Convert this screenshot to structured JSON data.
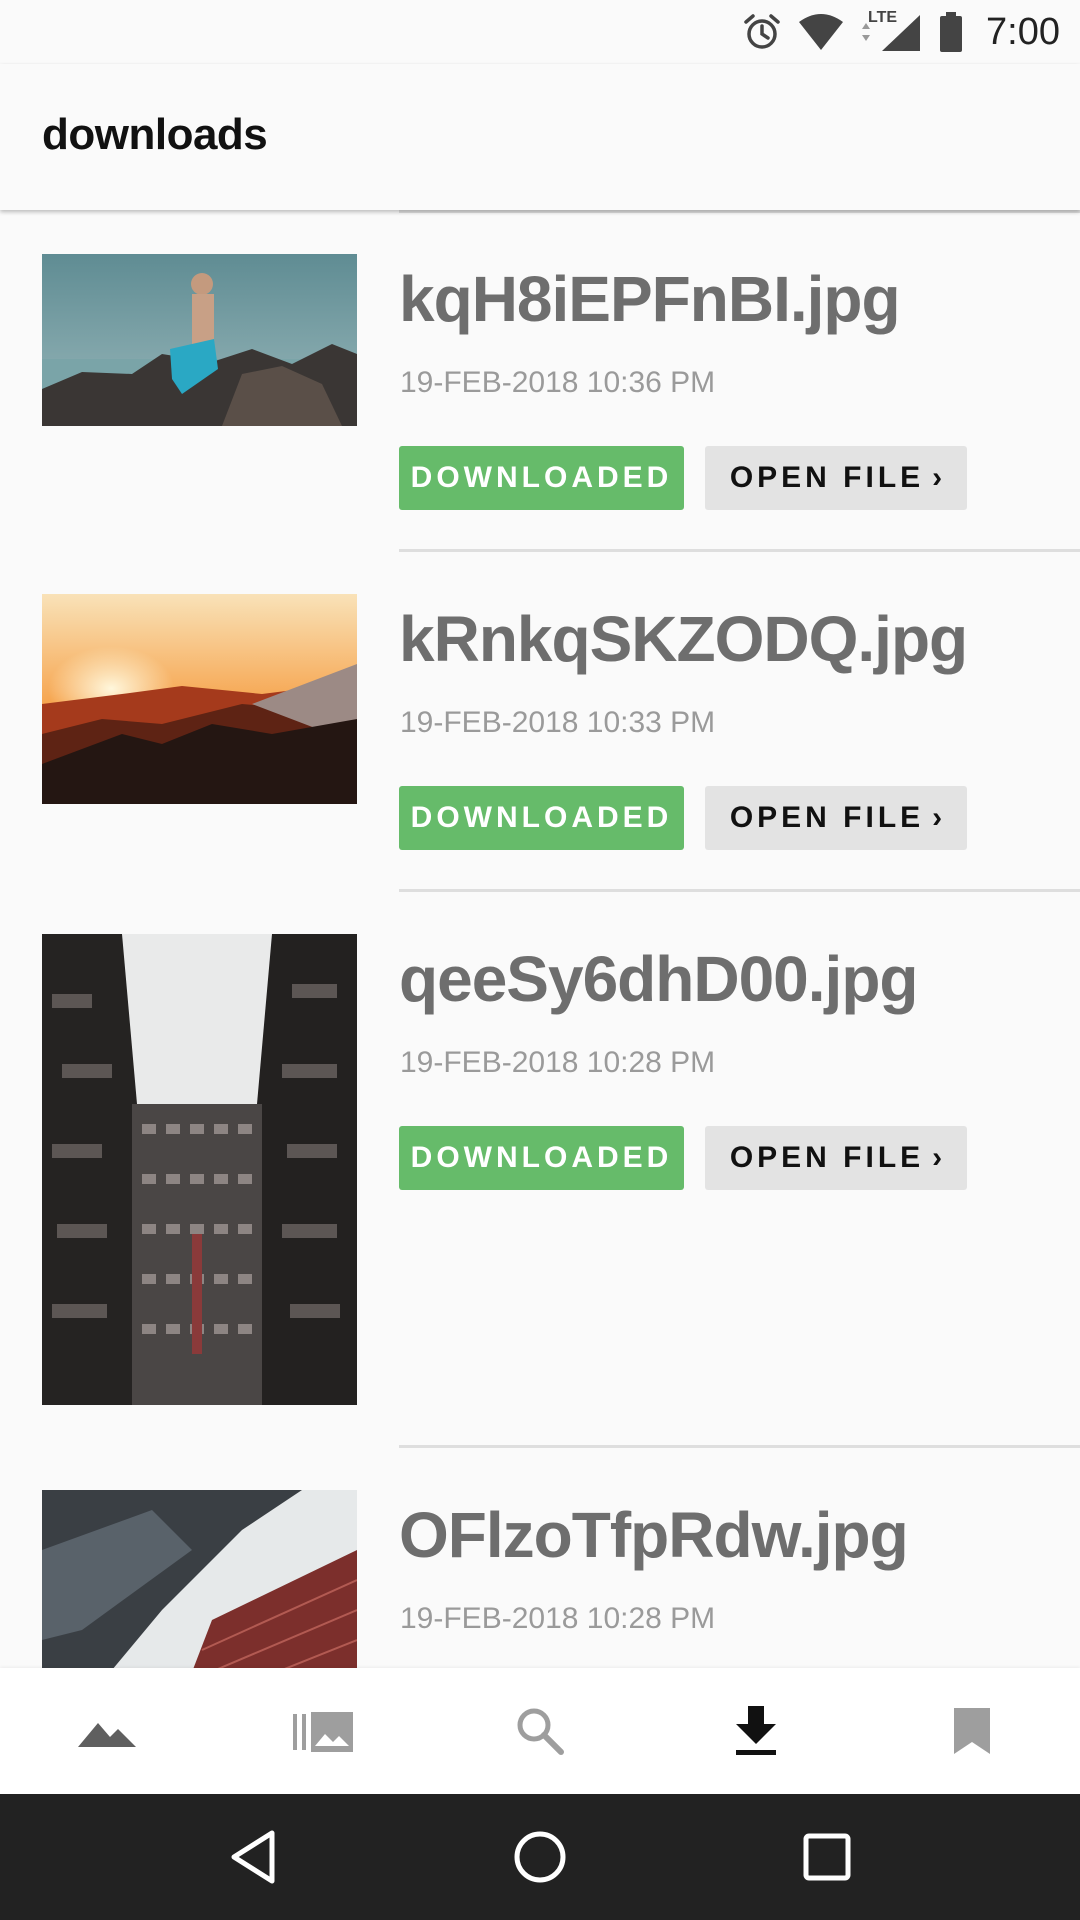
{
  "status_bar": {
    "time": "7:00",
    "network_label": "LTE"
  },
  "app_bar": {
    "title": "downloads"
  },
  "downloads": [
    {
      "filename": "kqH8iEPFnBI.jpg",
      "date": "19-FEB-2018 10:36 PM",
      "status_label": "DOWNLOADED",
      "open_label": "OPEN FILE"
    },
    {
      "filename": "kRnkqSKZODQ.jpg",
      "date": "19-FEB-2018 10:33 PM",
      "status_label": "DOWNLOADED",
      "open_label": "OPEN FILE"
    },
    {
      "filename": "qeeSy6dhD00.jpg",
      "date": "19-FEB-2018 10:28 PM",
      "status_label": "DOWNLOADED",
      "open_label": "OPEN FILE"
    },
    {
      "filename": "OFlzoTfpRdw.jpg",
      "date": "19-FEB-2018 10:28 PM"
    }
  ],
  "bottom_nav": {
    "tabs": [
      {
        "icon": "landscape-icon",
        "active": false
      },
      {
        "icon": "collections-icon",
        "active": false
      },
      {
        "icon": "search-icon",
        "active": false
      },
      {
        "icon": "download-icon",
        "active": true
      },
      {
        "icon": "bookmark-icon",
        "active": false
      }
    ]
  },
  "system_nav": {
    "buttons": [
      "back-icon",
      "home-icon",
      "recents-icon"
    ]
  },
  "colors": {
    "downloaded_bg": "#66bb6a",
    "open_bg": "#e3e3e3",
    "filename": "#6e6e6e",
    "date": "#9a9a9a",
    "active_icon": "#111111",
    "inactive_icon": "#9e9e9e"
  }
}
